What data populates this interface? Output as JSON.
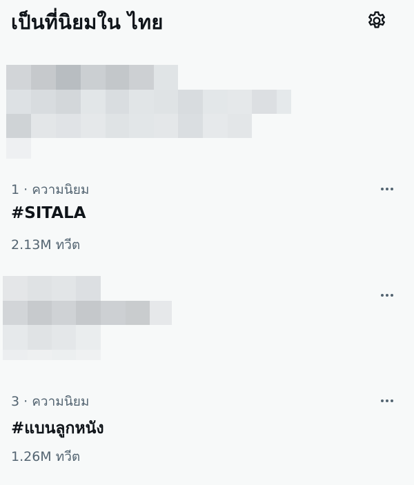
{
  "header": {
    "title": "เป็นที่นิยมใน ไทย",
    "settings_icon": "gear-icon"
  },
  "trends": [
    {
      "rank_meta": "1 · ความนิยม",
      "name": "#SITALA",
      "count": "2.13M ทวีต",
      "more_icon": "more-horizontal-icon"
    },
    {
      "rank_meta": "3 · ความนิยม",
      "name": "#แบนลูกหนัง",
      "count": "1.26M ทวีต",
      "more_icon": "more-horizontal-icon"
    }
  ],
  "colors": {
    "background": "#f7f9f9",
    "primary_text": "#0f1419",
    "secondary_text": "#536471"
  }
}
